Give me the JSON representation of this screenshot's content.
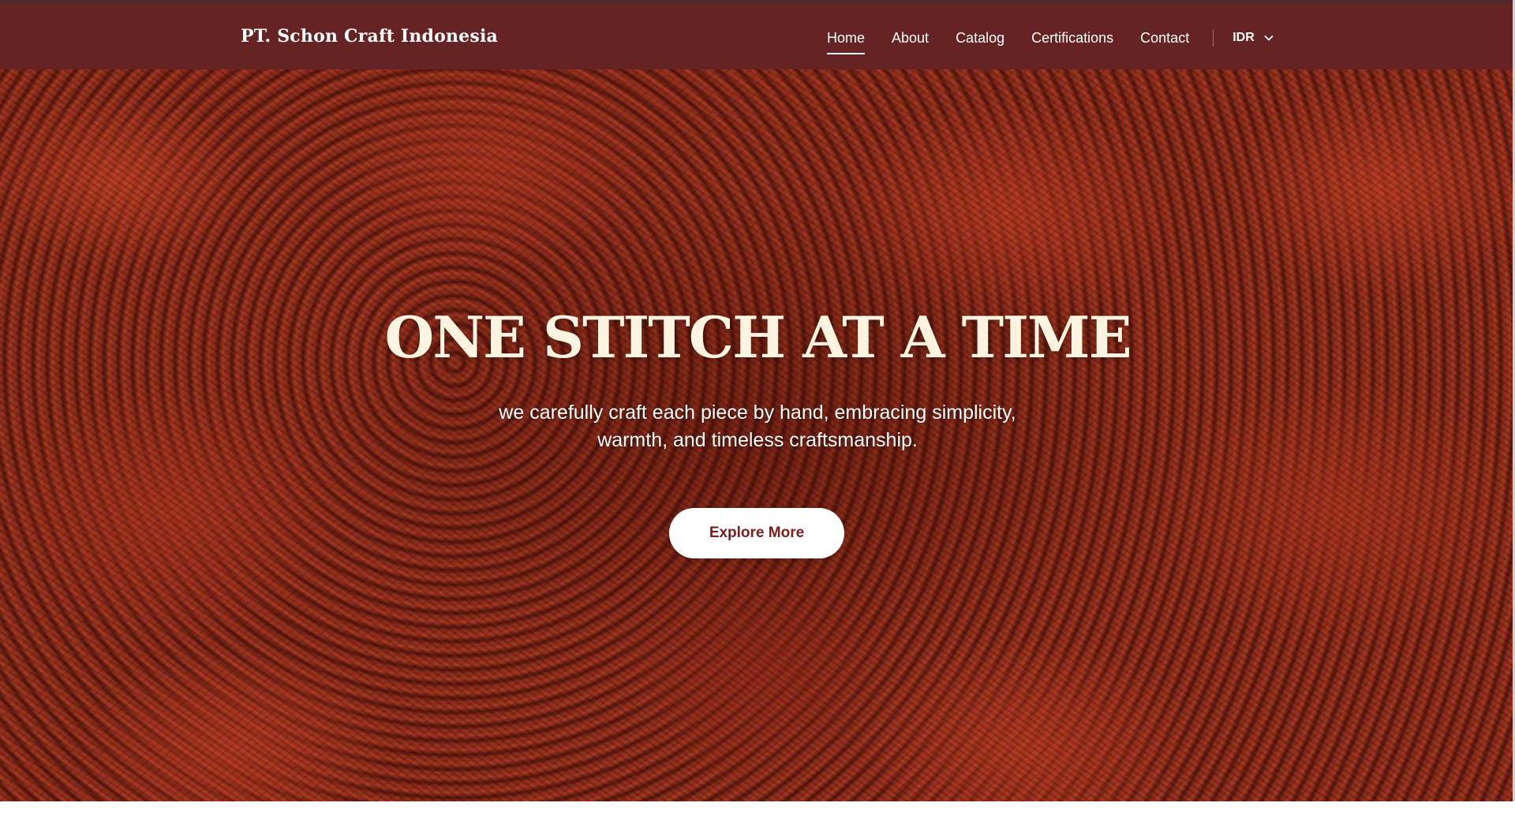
{
  "header": {
    "brand": "PT. Schon Craft Indonesia",
    "nav": [
      {
        "label": "Home",
        "active": true
      },
      {
        "label": "About",
        "active": false
      },
      {
        "label": "Catalog",
        "active": false
      },
      {
        "label": "Certifications",
        "active": false
      },
      {
        "label": "Contact",
        "active": false
      }
    ],
    "currency": "IDR",
    "currency_icon": "chevron-down-icon"
  },
  "hero": {
    "title": "ONE STITCH AT A TIME",
    "subtitle_line1": "we carefully craft each piece by hand, embracing simplicity,",
    "subtitle_line2": "warmth, and timeless craftsmanship.",
    "cta_label": "Explore More",
    "background_image": "red crochet knitted texture"
  },
  "colors": {
    "header_bg": "#662324",
    "hero_title": "#fdf3e1",
    "cta_text": "#7a1e1e",
    "cta_bg": "#ffffff"
  }
}
